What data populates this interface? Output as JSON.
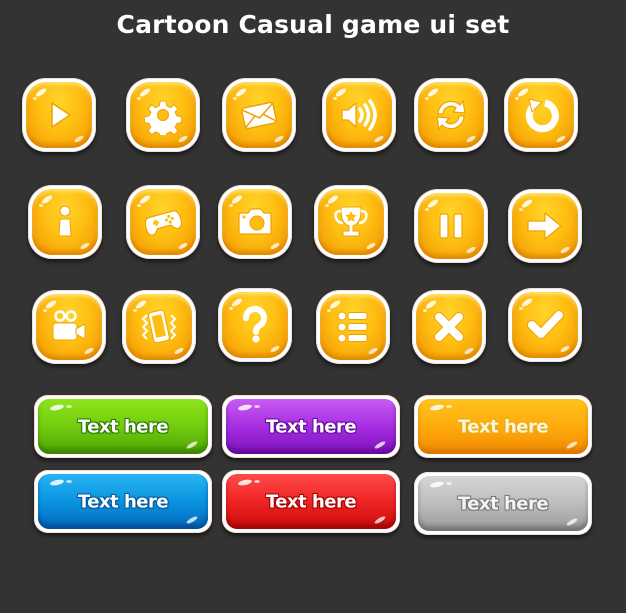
{
  "title": "Cartoon Casual game ui set",
  "colors": {
    "background": "#333333",
    "icon_button": "#ffbe12",
    "green": "#72cc0e",
    "purple": "#a62ee0",
    "orange": "#ffab0c",
    "blue": "#0a94e0",
    "red": "#f02424",
    "grey": "#bdbdbd"
  },
  "icon_buttons": [
    [
      {
        "icon": "play-icon"
      },
      {
        "icon": "gear-icon"
      },
      {
        "icon": "mail-icon"
      },
      {
        "icon": "sound-icon"
      },
      {
        "icon": "refresh-icon"
      },
      {
        "icon": "restart-icon"
      }
    ],
    [
      {
        "icon": "info-icon"
      },
      {
        "icon": "gamepad-icon"
      },
      {
        "icon": "camera-icon"
      },
      {
        "icon": "trophy-icon"
      },
      {
        "icon": "pause-icon"
      },
      {
        "icon": "arrow-right-icon"
      }
    ],
    [
      {
        "icon": "video-camera-icon"
      },
      {
        "icon": "vibrate-icon"
      },
      {
        "icon": "help-icon"
      },
      {
        "icon": "list-icon"
      },
      {
        "icon": "close-icon"
      },
      {
        "icon": "check-icon"
      }
    ]
  ],
  "text_buttons": [
    {
      "label": "Text here",
      "color": "green"
    },
    {
      "label": "Text here",
      "color": "purple"
    },
    {
      "label": "Text here",
      "color": "orange"
    },
    {
      "label": "Text here",
      "color": "blue"
    },
    {
      "label": "Text here",
      "color": "red"
    },
    {
      "label": "Text here",
      "color": "grey"
    }
  ]
}
